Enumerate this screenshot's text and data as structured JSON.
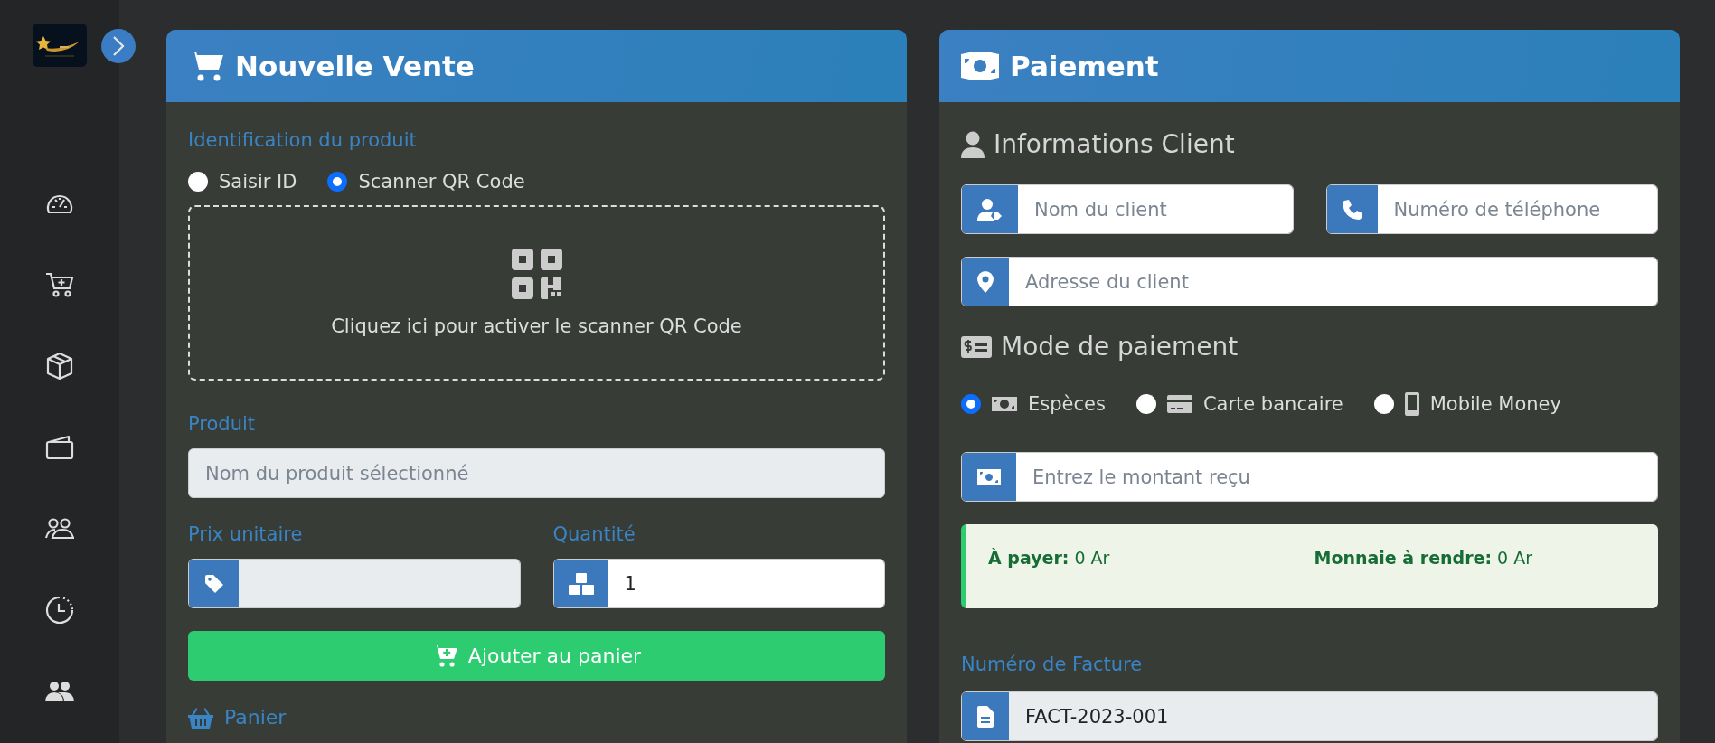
{
  "sale": {
    "title": "Nouvelle Vente",
    "identification": {
      "label": "Identification du produit",
      "options": [
        {
          "label": "Saisir ID",
          "selected": false
        },
        {
          "label": "Scanner QR Code",
          "selected": true
        }
      ]
    },
    "scanner": {
      "prompt": "Cliquez ici pour activer le scanner QR Code"
    },
    "product": {
      "label": "Produit",
      "placeholder": "Nom du produit sélectionné",
      "disabled": true
    },
    "unit_price": {
      "label": "Prix unitaire",
      "disabled": true
    },
    "quantity": {
      "label": "Quantité",
      "value": "1",
      "disabled": false
    },
    "add_button": "Ajouter au panier",
    "cart_heading": "Panier"
  },
  "payment": {
    "title": "Paiement",
    "client_heading": "Informations Client",
    "client_fields": [
      {
        "kind": "person",
        "placeholder": "Nom du client"
      },
      {
        "kind": "phone",
        "placeholder": "Numéro de téléphone"
      },
      {
        "kind": "location",
        "placeholder": "Adresse du client"
      }
    ],
    "method_heading": "Mode de paiement",
    "methods": [
      {
        "kind": "cash",
        "label": "Espèces",
        "selected": true
      },
      {
        "kind": "card",
        "label": "Carte bancaire",
        "selected": false
      },
      {
        "kind": "mobile",
        "label": "Mobile Money",
        "selected": false
      }
    ],
    "amount": {
      "placeholder": "Entrez le montant reçu"
    },
    "summary": [
      {
        "label": "À payer:",
        "value": "0 Ar"
      },
      {
        "label": "Monnaie à rendre:",
        "value": "0 Ar"
      }
    ],
    "invoice": {
      "label": "Numéro de Facture",
      "value": "FACT-2023-001",
      "disabled": true
    }
  }
}
